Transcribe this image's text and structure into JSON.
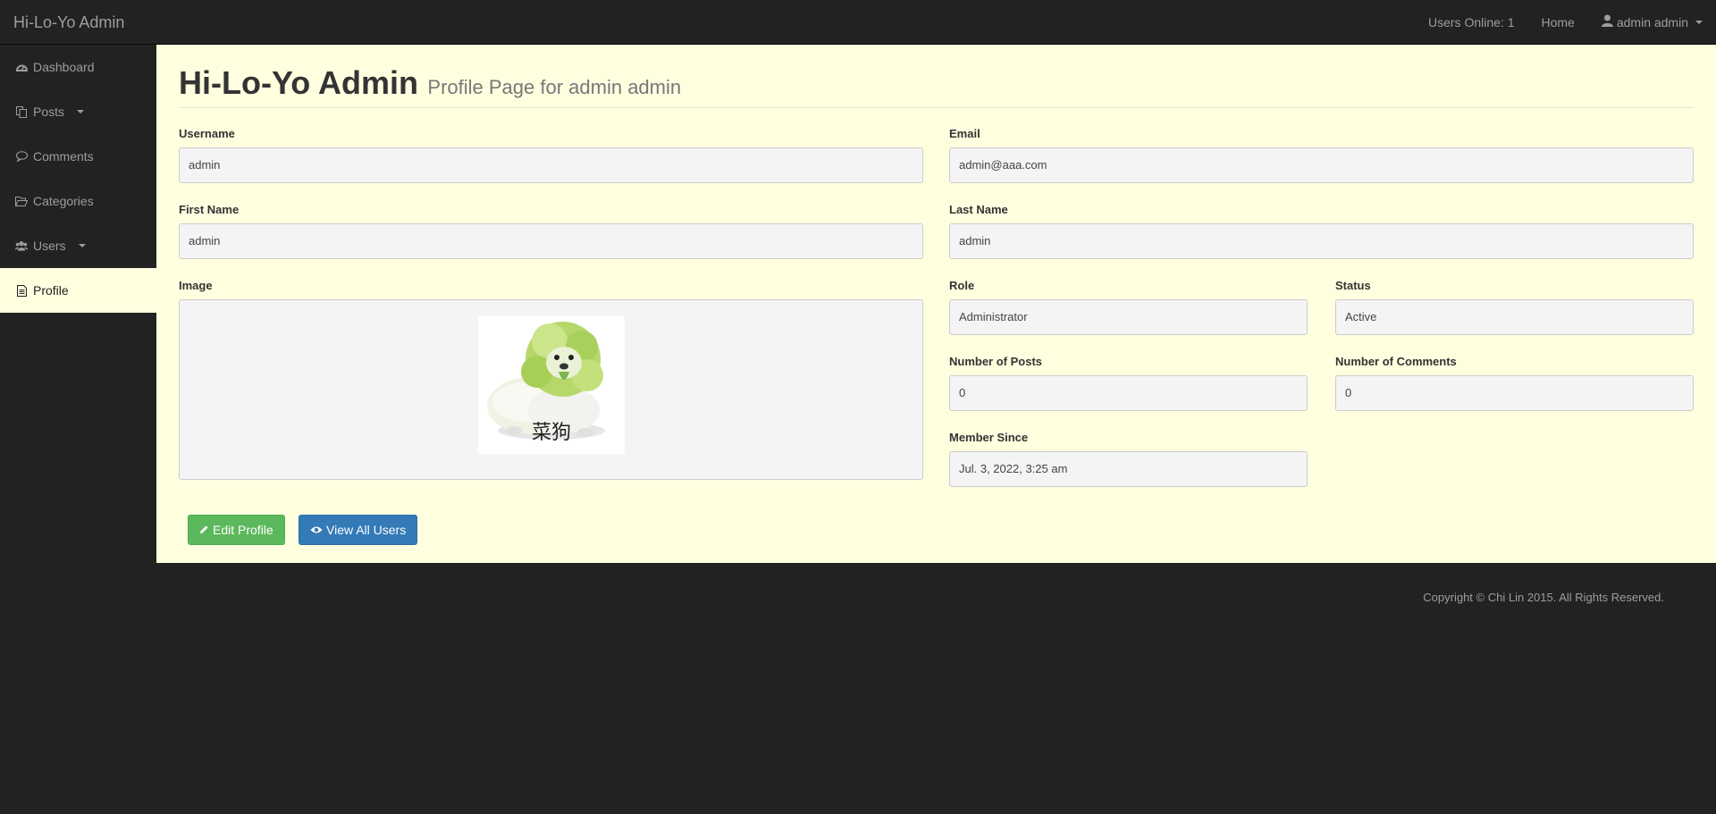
{
  "navbar": {
    "brand": "Hi-Lo-Yo Admin",
    "users_online": "Users Online: 1",
    "home": "Home",
    "user": "admin admin"
  },
  "sidebar": {
    "items": [
      {
        "label": "Dashboard",
        "icon": "dashboard-icon"
      },
      {
        "label": "Posts",
        "icon": "files-icon"
      },
      {
        "label": "Comments",
        "icon": "comment-icon"
      },
      {
        "label": "Categories",
        "icon": "folder-open-icon"
      },
      {
        "label": "Users",
        "icon": "users-icon"
      },
      {
        "label": "Profile",
        "icon": "file-text-icon"
      }
    ]
  },
  "header": {
    "title": "Hi-Lo-Yo Admin",
    "subtitle": "Profile Page for admin admin"
  },
  "form": {
    "username": {
      "label": "Username",
      "value": "admin"
    },
    "email": {
      "label": "Email",
      "value": "admin@aaa.com"
    },
    "first_name": {
      "label": "First Name",
      "value": "admin"
    },
    "last_name": {
      "label": "Last Name",
      "value": "admin"
    },
    "image": {
      "label": "Image",
      "caption": "菜狗"
    },
    "role": {
      "label": "Role",
      "value": "Administrator"
    },
    "status": {
      "label": "Status",
      "value": "Active"
    },
    "num_posts": {
      "label": "Number of Posts",
      "value": "0"
    },
    "num_comments": {
      "label": "Number of Comments",
      "value": "0"
    },
    "member_since": {
      "label": "Member Since",
      "value": "Jul. 3, 2022, 3:25 am"
    }
  },
  "actions": {
    "edit": "Edit Profile",
    "view_users": "View All Users"
  },
  "footer": {
    "copyright": "Copyright © Chi Lin 2015. All Rights Reserved."
  },
  "colors": {
    "accent_success": "#5cb85c",
    "accent_primary": "#337ab7",
    "content_bg": "#ffffe0",
    "chrome_bg": "#222222"
  }
}
